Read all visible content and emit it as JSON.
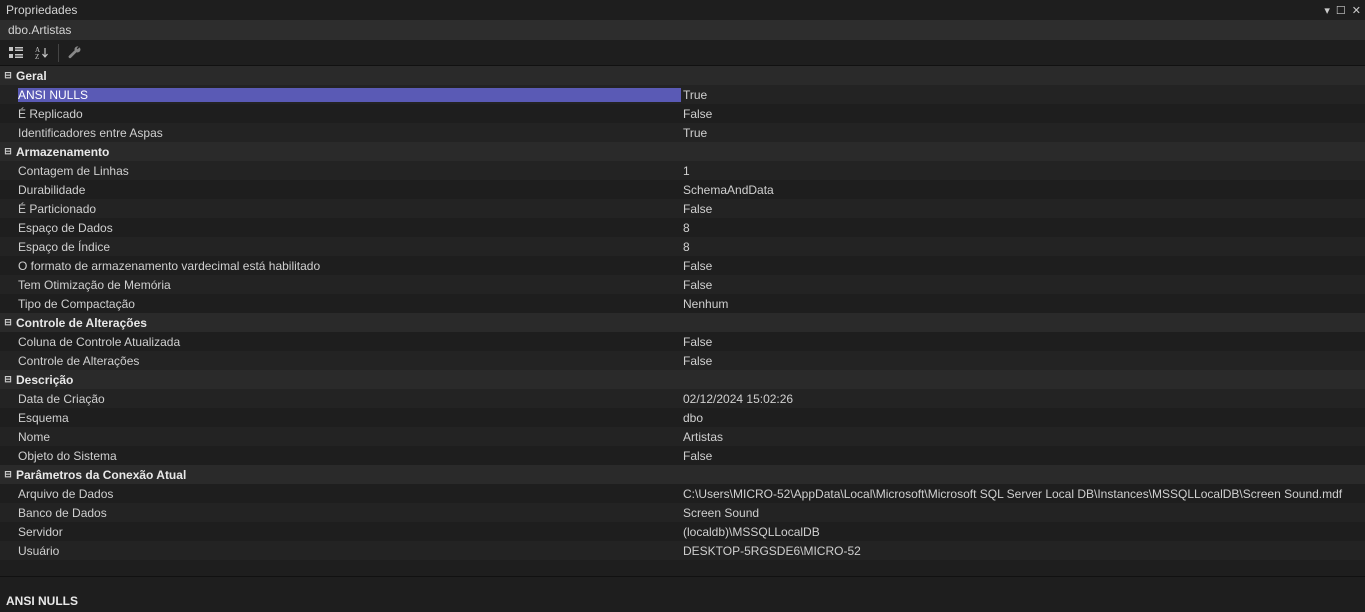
{
  "panel": {
    "title": "Propriedades",
    "object_name": "dbo.Artistas"
  },
  "toolbar": {
    "categorized_tooltip": "Categorizado",
    "alpha_tooltip": "Alfabético",
    "properties_tooltip": "Páginas de Propriedades"
  },
  "categories": [
    {
      "label": "Geral",
      "rows": [
        {
          "name": "ANSI NULLS",
          "value": "True",
          "selected": true
        },
        {
          "name": "É Replicado",
          "value": "False"
        },
        {
          "name": "Identificadores entre Aspas",
          "value": "True"
        }
      ]
    },
    {
      "label": "Armazenamento",
      "rows": [
        {
          "name": "Contagem de Linhas",
          "value": "1"
        },
        {
          "name": "Durabilidade",
          "value": "SchemaAndData"
        },
        {
          "name": "É Particionado",
          "value": "False"
        },
        {
          "name": "Espaço de Dados",
          "value": "8"
        },
        {
          "name": "Espaço de Índice",
          "value": "8"
        },
        {
          "name": "O formato de armazenamento vardecimal está habilitado",
          "value": "False"
        },
        {
          "name": "Tem Otimização de Memória",
          "value": "False"
        },
        {
          "name": "Tipo de Compactação",
          "value": "Nenhum"
        }
      ]
    },
    {
      "label": "Controle de Alterações",
      "rows": [
        {
          "name": "Coluna de Controle Atualizada",
          "value": "False"
        },
        {
          "name": "Controle de Alterações",
          "value": "False"
        }
      ]
    },
    {
      "label": "Descrição",
      "rows": [
        {
          "name": "Data de Criação",
          "value": "02/12/2024 15:02:26"
        },
        {
          "name": "Esquema",
          "value": "dbo"
        },
        {
          "name": "Nome",
          "value": "Artistas"
        },
        {
          "name": "Objeto do Sistema",
          "value": "False"
        }
      ]
    },
    {
      "label": "Parâmetros da Conexão Atual",
      "rows": [
        {
          "name": "Arquivo de Dados",
          "value": "C:\\Users\\MICRO-52\\AppData\\Local\\Microsoft\\Microsoft SQL Server Local DB\\Instances\\MSSQLLocalDB\\Screen Sound.mdf"
        },
        {
          "name": "Banco de Dados",
          "value": "Screen Sound"
        },
        {
          "name": "Servidor",
          "value": "(localdb)\\MSSQLLocalDB"
        },
        {
          "name": "Usuário",
          "value": "DESKTOP-5RGSDE6\\MICRO-52"
        }
      ]
    }
  ],
  "footer": {
    "selected_name": "ANSI NULLS"
  }
}
